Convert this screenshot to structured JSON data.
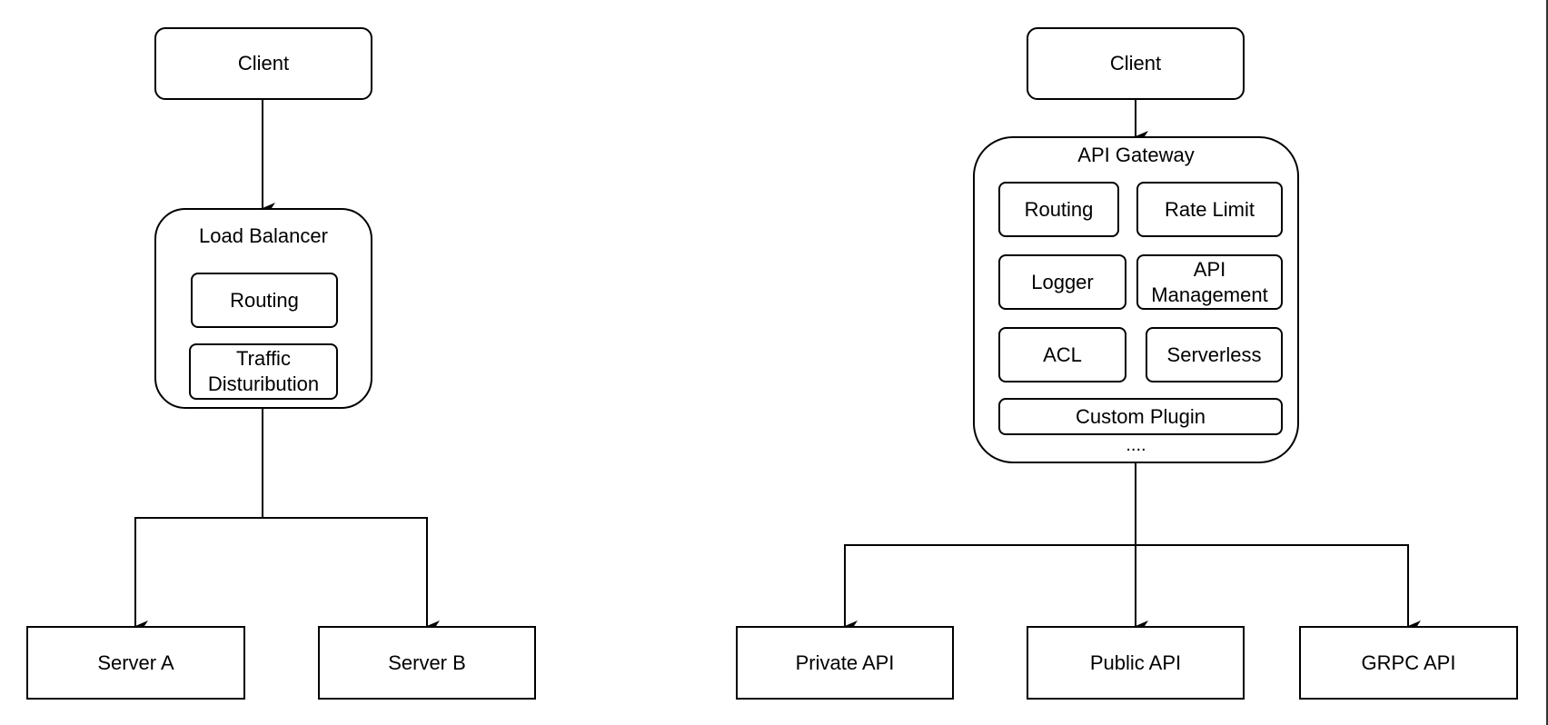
{
  "left_diagram": {
    "client": "Client",
    "load_balancer": {
      "title": "Load Balancer",
      "components": [
        "Routing",
        "Traffic Disturibution"
      ]
    },
    "servers": [
      "Server A",
      "Server B"
    ]
  },
  "right_diagram": {
    "client": "Client",
    "api_gateway": {
      "title": "API Gateway",
      "components": [
        "Routing",
        "Rate Limit",
        "Logger",
        "API Management",
        "ACL",
        "Serverless",
        "Custom Plugin"
      ],
      "more": "...."
    },
    "apis": [
      "Private API",
      "Public API",
      "GRPC API"
    ]
  },
  "colors": {
    "stroke": "#000000",
    "background": "#ffffff"
  }
}
